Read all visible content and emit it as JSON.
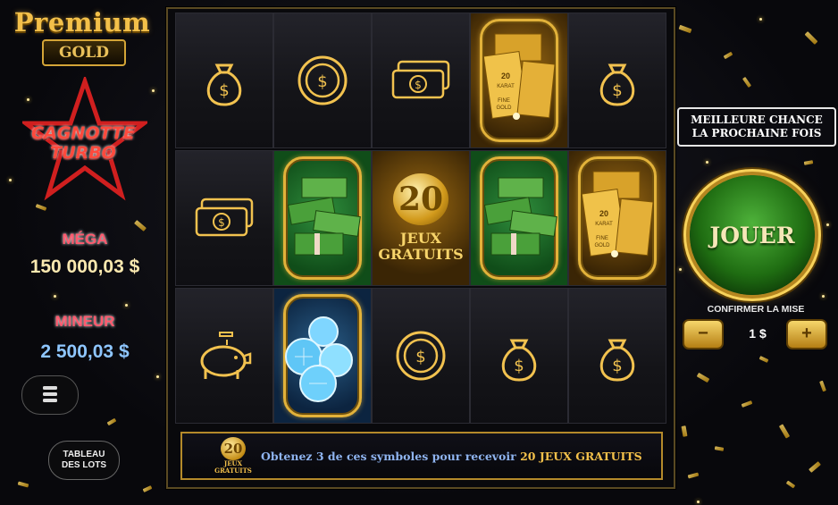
{
  "brand": {
    "title": "Premium",
    "subtitle": "GOLD"
  },
  "jackpot_logo": {
    "line1": "CAGNOTTE",
    "line2": "TURBO"
  },
  "jackpots": [
    {
      "label": "MÉGA",
      "value": "150 000,03 $",
      "label_color": "#ff5a6e",
      "value_color": "#fbe9b0"
    },
    {
      "label": "MINEUR",
      "value": "2 500,03 $",
      "label_color": "#ff5a6e",
      "value_color": "#8ec6ff"
    }
  ],
  "buttons": {
    "menu_icon": "menu-icon",
    "tableau_line1": "TABLEAU",
    "tableau_line2": "DES LOTS",
    "jouer": "JOUER",
    "minus": "−",
    "plus": "+"
  },
  "grid": {
    "rows": [
      [
        "money-bag-icon",
        "coin-icon",
        "cash-bill-icon",
        "gold-bars",
        "money-bag-icon"
      ],
      [
        "cash-bill-icon",
        "cash-stack",
        "free-games-20",
        "cash-stack",
        "gold-bars"
      ],
      [
        "piggy-bank-icon",
        "diamonds",
        "coin-icon",
        "money-bag-icon",
        "money-bag-icon"
      ]
    ],
    "free_games_number": "20",
    "free_games_line1": "JEUX",
    "free_games_line2": "GRATUITS",
    "gold_bar_text1": "20",
    "gold_bar_text2": "KARAT",
    "gold_bar_text3": "FINE",
    "gold_bar_text4": "GOLD"
  },
  "info_bar": {
    "badge_number": "20",
    "badge_line1": "JEUX",
    "badge_line2": "GRATUITS",
    "text_before": "Obtenez 3 de ces symboles pour recevoir ",
    "text_highlight": "20 JEUX GRATUITS"
  },
  "result": {
    "line1": "MEILLEURE CHANCE",
    "line2": "LA PROCHAINE FOIS"
  },
  "bet": {
    "label": "CONFIRMER LA MISE",
    "value": "1 $"
  },
  "colors": {
    "gold": "#e2b23a",
    "green": "#1f6d12",
    "info_text": "#8fb4f0"
  }
}
